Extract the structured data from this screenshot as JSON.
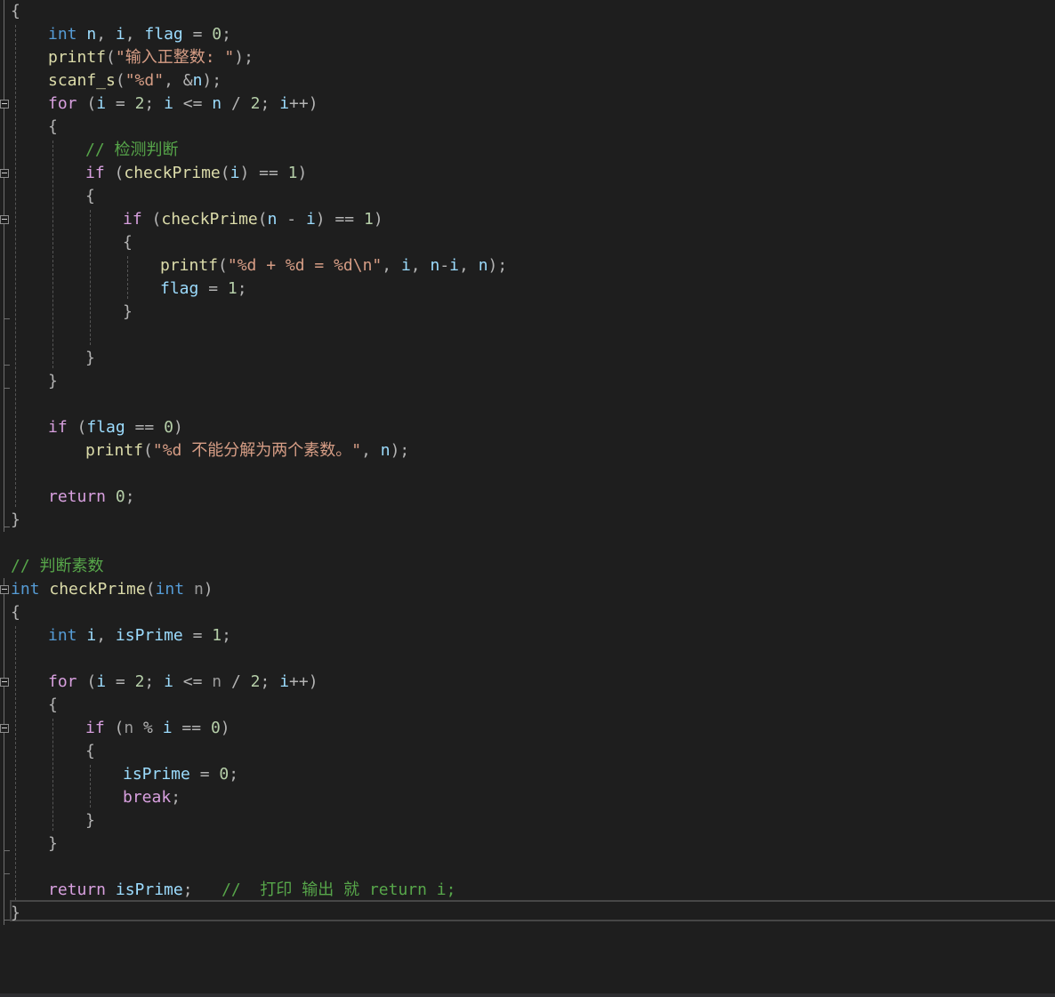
{
  "editor": {
    "current_line": 39,
    "lines": [
      {
        "indent": 0,
        "tokens": [
          {
            "t": "{",
            "c": "pun"
          }
        ]
      },
      {
        "indent": 1,
        "tokens": [
          {
            "t": "int",
            "c": "kw"
          },
          {
            "t": " ",
            "c": ""
          },
          {
            "t": "n",
            "c": "var"
          },
          {
            "t": ", ",
            "c": "pun"
          },
          {
            "t": "i",
            "c": "var"
          },
          {
            "t": ", ",
            "c": "pun"
          },
          {
            "t": "flag",
            "c": "var"
          },
          {
            "t": " = ",
            "c": "pun"
          },
          {
            "t": "0",
            "c": "num"
          },
          {
            "t": ";",
            "c": "pun"
          }
        ]
      },
      {
        "indent": 1,
        "tokens": [
          {
            "t": "printf",
            "c": "fn"
          },
          {
            "t": "(",
            "c": "pun"
          },
          {
            "t": "\"输入正整数: \"",
            "c": "str"
          },
          {
            "t": ");",
            "c": "pun"
          }
        ]
      },
      {
        "indent": 1,
        "tokens": [
          {
            "t": "scanf_s",
            "c": "fn"
          },
          {
            "t": "(",
            "c": "pun"
          },
          {
            "t": "\"%d\"",
            "c": "str"
          },
          {
            "t": ", &",
            "c": "pun"
          },
          {
            "t": "n",
            "c": "var"
          },
          {
            "t": ");",
            "c": "pun"
          }
        ]
      },
      {
        "indent": 1,
        "tokens": [
          {
            "t": "for",
            "c": "ctl"
          },
          {
            "t": " (",
            "c": "pun"
          },
          {
            "t": "i",
            "c": "var"
          },
          {
            "t": " = ",
            "c": "pun"
          },
          {
            "t": "2",
            "c": "num"
          },
          {
            "t": "; ",
            "c": "pun"
          },
          {
            "t": "i",
            "c": "var"
          },
          {
            "t": " <= ",
            "c": "pun"
          },
          {
            "t": "n",
            "c": "var"
          },
          {
            "t": " / ",
            "c": "pun"
          },
          {
            "t": "2",
            "c": "num"
          },
          {
            "t": "; ",
            "c": "pun"
          },
          {
            "t": "i",
            "c": "var"
          },
          {
            "t": "++)",
            "c": "pun"
          }
        ]
      },
      {
        "indent": 1,
        "tokens": [
          {
            "t": "{",
            "c": "pun"
          }
        ]
      },
      {
        "indent": 2,
        "tokens": [
          {
            "t": "// 检测判断",
            "c": "cmt"
          }
        ]
      },
      {
        "indent": 2,
        "tokens": [
          {
            "t": "if",
            "c": "ctl"
          },
          {
            "t": " (",
            "c": "pun"
          },
          {
            "t": "checkPrime",
            "c": "fn"
          },
          {
            "t": "(",
            "c": "pun"
          },
          {
            "t": "i",
            "c": "var"
          },
          {
            "t": ") == ",
            "c": "pun"
          },
          {
            "t": "1",
            "c": "num"
          },
          {
            "t": ")",
            "c": "pun"
          }
        ]
      },
      {
        "indent": 2,
        "tokens": [
          {
            "t": "{",
            "c": "pun"
          }
        ]
      },
      {
        "indent": 3,
        "tokens": [
          {
            "t": "if",
            "c": "ctl"
          },
          {
            "t": " (",
            "c": "pun"
          },
          {
            "t": "checkPrime",
            "c": "fn"
          },
          {
            "t": "(",
            "c": "pun"
          },
          {
            "t": "n",
            "c": "var"
          },
          {
            "t": " - ",
            "c": "pun"
          },
          {
            "t": "i",
            "c": "var"
          },
          {
            "t": ") == ",
            "c": "pun"
          },
          {
            "t": "1",
            "c": "num"
          },
          {
            "t": ")",
            "c": "pun"
          }
        ]
      },
      {
        "indent": 3,
        "tokens": [
          {
            "t": "{",
            "c": "pun"
          }
        ]
      },
      {
        "indent": 4,
        "tokens": [
          {
            "t": "printf",
            "c": "fn"
          },
          {
            "t": "(",
            "c": "pun"
          },
          {
            "t": "\"%d + %d = %d\\n\"",
            "c": "str"
          },
          {
            "t": ", ",
            "c": "pun"
          },
          {
            "t": "i",
            "c": "var"
          },
          {
            "t": ", ",
            "c": "pun"
          },
          {
            "t": "n",
            "c": "var"
          },
          {
            "t": "-",
            "c": "pun"
          },
          {
            "t": "i",
            "c": "var"
          },
          {
            "t": ", ",
            "c": "pun"
          },
          {
            "t": "n",
            "c": "var"
          },
          {
            "t": ");",
            "c": "pun"
          }
        ]
      },
      {
        "indent": 4,
        "tokens": [
          {
            "t": "flag",
            "c": "var"
          },
          {
            "t": " = ",
            "c": "pun"
          },
          {
            "t": "1",
            "c": "num"
          },
          {
            "t": ";",
            "c": "pun"
          }
        ]
      },
      {
        "indent": 3,
        "tokens": [
          {
            "t": "}",
            "c": "pun"
          }
        ]
      },
      {
        "indent": 0,
        "tokens": []
      },
      {
        "indent": 2,
        "tokens": [
          {
            "t": "}",
            "c": "pun"
          }
        ]
      },
      {
        "indent": 1,
        "tokens": [
          {
            "t": "}",
            "c": "pun"
          }
        ]
      },
      {
        "indent": 0,
        "tokens": []
      },
      {
        "indent": 1,
        "tokens": [
          {
            "t": "if",
            "c": "ctl"
          },
          {
            "t": " (",
            "c": "pun"
          },
          {
            "t": "flag",
            "c": "var"
          },
          {
            "t": " == ",
            "c": "pun"
          },
          {
            "t": "0",
            "c": "num"
          },
          {
            "t": ")",
            "c": "pun"
          }
        ]
      },
      {
        "indent": 2,
        "tokens": [
          {
            "t": "printf",
            "c": "fn"
          },
          {
            "t": "(",
            "c": "pun"
          },
          {
            "t": "\"%d 不能分解为两个素数。\"",
            "c": "str"
          },
          {
            "t": ", ",
            "c": "pun"
          },
          {
            "t": "n",
            "c": "var"
          },
          {
            "t": ");",
            "c": "pun"
          }
        ]
      },
      {
        "indent": 0,
        "tokens": []
      },
      {
        "indent": 1,
        "tokens": [
          {
            "t": "return",
            "c": "ctl"
          },
          {
            "t": " ",
            "c": ""
          },
          {
            "t": "0",
            "c": "num"
          },
          {
            "t": ";",
            "c": "pun"
          }
        ]
      },
      {
        "indent": 0,
        "tokens": [
          {
            "t": "}",
            "c": "pun"
          }
        ]
      },
      {
        "indent": 0,
        "tokens": []
      },
      {
        "indent": 0,
        "tokens": [
          {
            "t": "// 判断素数",
            "c": "cmt"
          }
        ]
      },
      {
        "indent": 0,
        "tokens": [
          {
            "t": "int",
            "c": "kw"
          },
          {
            "t": " ",
            "c": ""
          },
          {
            "t": "checkPrime",
            "c": "fn"
          },
          {
            "t": "(",
            "c": "pun"
          },
          {
            "t": "int",
            "c": "kw"
          },
          {
            "t": " ",
            "c": ""
          },
          {
            "t": "n",
            "c": "prm"
          },
          {
            "t": ")",
            "c": "pun"
          }
        ]
      },
      {
        "indent": 0,
        "tokens": [
          {
            "t": "{",
            "c": "pun"
          }
        ]
      },
      {
        "indent": 1,
        "tokens": [
          {
            "t": "int",
            "c": "kw"
          },
          {
            "t": " ",
            "c": ""
          },
          {
            "t": "i",
            "c": "var"
          },
          {
            "t": ", ",
            "c": "pun"
          },
          {
            "t": "isPrime",
            "c": "var"
          },
          {
            "t": " = ",
            "c": "pun"
          },
          {
            "t": "1",
            "c": "num"
          },
          {
            "t": ";",
            "c": "pun"
          }
        ]
      },
      {
        "indent": 0,
        "tokens": []
      },
      {
        "indent": 1,
        "tokens": [
          {
            "t": "for",
            "c": "ctl"
          },
          {
            "t": " (",
            "c": "pun"
          },
          {
            "t": "i",
            "c": "var"
          },
          {
            "t": " = ",
            "c": "pun"
          },
          {
            "t": "2",
            "c": "num"
          },
          {
            "t": "; ",
            "c": "pun"
          },
          {
            "t": "i",
            "c": "var"
          },
          {
            "t": " <= ",
            "c": "pun"
          },
          {
            "t": "n",
            "c": "prm"
          },
          {
            "t": " / ",
            "c": "pun"
          },
          {
            "t": "2",
            "c": "num"
          },
          {
            "t": "; ",
            "c": "pun"
          },
          {
            "t": "i",
            "c": "var"
          },
          {
            "t": "++)",
            "c": "pun"
          }
        ]
      },
      {
        "indent": 1,
        "tokens": [
          {
            "t": "{",
            "c": "pun"
          }
        ]
      },
      {
        "indent": 2,
        "tokens": [
          {
            "t": "if",
            "c": "ctl"
          },
          {
            "t": " (",
            "c": "pun"
          },
          {
            "t": "n",
            "c": "prm"
          },
          {
            "t": " % ",
            "c": "pun"
          },
          {
            "t": "i",
            "c": "var"
          },
          {
            "t": " == ",
            "c": "pun"
          },
          {
            "t": "0",
            "c": "num"
          },
          {
            "t": ")",
            "c": "pun"
          }
        ]
      },
      {
        "indent": 2,
        "tokens": [
          {
            "t": "{",
            "c": "pun"
          }
        ]
      },
      {
        "indent": 3,
        "tokens": [
          {
            "t": "isPrime",
            "c": "var"
          },
          {
            "t": " = ",
            "c": "pun"
          },
          {
            "t": "0",
            "c": "num"
          },
          {
            "t": ";",
            "c": "pun"
          }
        ]
      },
      {
        "indent": 3,
        "tokens": [
          {
            "t": "break",
            "c": "ctl"
          },
          {
            "t": ";",
            "c": "pun"
          }
        ]
      },
      {
        "indent": 2,
        "tokens": [
          {
            "t": "}",
            "c": "pun"
          }
        ]
      },
      {
        "indent": 1,
        "tokens": [
          {
            "t": "}",
            "c": "pun"
          }
        ]
      },
      {
        "indent": 0,
        "tokens": []
      },
      {
        "indent": 1,
        "tokens": [
          {
            "t": "return",
            "c": "ctl"
          },
          {
            "t": " ",
            "c": ""
          },
          {
            "t": "isPrime",
            "c": "var"
          },
          {
            "t": ";",
            "c": "pun"
          },
          {
            "t": "   //  打印 输出 就 return i;",
            "c": "cmt"
          }
        ]
      },
      {
        "indent": 0,
        "tokens": [
          {
            "t": "}",
            "c": "pun"
          }
        ]
      }
    ]
  }
}
